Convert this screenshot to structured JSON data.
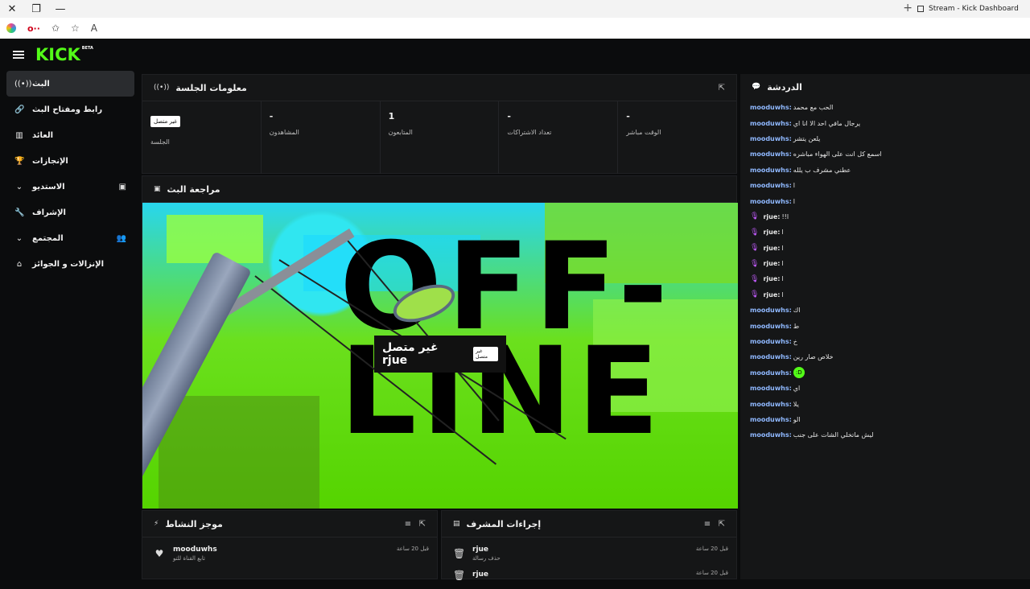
{
  "browser": {
    "tab_title": "Stream - Kick Dashboard",
    "close_glyph": "✕",
    "restore_glyph": "❐",
    "minimize_glyph": "—",
    "newtab_glyph": "+"
  },
  "app": {
    "logo": "KICK",
    "beta": "BETA"
  },
  "sidebar": {
    "items": [
      {
        "label": "البث",
        "icon": "((•))",
        "active": true
      },
      {
        "label": "رابط ومفتاح البث",
        "icon": "🔗"
      },
      {
        "label": "العائد",
        "icon": "▥"
      },
      {
        "label": "الإنجازات",
        "icon": "🏆"
      },
      {
        "label": "الاستديو",
        "icon": "⌄",
        "right_icon": "▣"
      },
      {
        "label": "الإشراف",
        "icon": "🔧"
      },
      {
        "label": "المجتمع",
        "icon": "⌄",
        "right_icon": "👥"
      },
      {
        "label": "الإنزالات و الجوائز",
        "icon": "⌂"
      }
    ]
  },
  "session_panel": {
    "title": "معلومات الجلسة",
    "stats": [
      {
        "value": "",
        "badge": "غير متصل",
        "label": "الجلسة"
      },
      {
        "value": "-",
        "label": "المشاهدون"
      },
      {
        "value": "1",
        "label": "المتابعون"
      },
      {
        "value": "-",
        "label": "تعداد الاشتراكات"
      },
      {
        "value": "-",
        "label": "الوقت مباشر"
      }
    ]
  },
  "preview_panel": {
    "title": "مراجعة البث",
    "offline_art": "OFF-\nLINE",
    "card_name": "غير متصل rjue",
    "card_badge": "غير متصل"
  },
  "chat": {
    "title": "الدردشة",
    "messages": [
      {
        "user": "mooduwhs:",
        "text": "الحب مع محمد"
      },
      {
        "user": "mooduwhs:",
        "text": "يرجال مافي احد الا انا اي"
      },
      {
        "user": "mooduwhs:",
        "text": "يلعن يتشر"
      },
      {
        "user": "mooduwhs:",
        "text": "اسمع كل انت على الهواء مباشره"
      },
      {
        "user": "mooduwhs:",
        "text": "عطني مشرف ب يلله"
      },
      {
        "user": "mooduwhs:",
        "text": "ا"
      },
      {
        "user": "mooduwhs:",
        "text": "ا"
      },
      {
        "user": "rjue:",
        "text": "!!ا",
        "mod": true
      },
      {
        "user": "rjue:",
        "text": "ا",
        "mod": true
      },
      {
        "user": "rjue:",
        "text": "ا",
        "mod": true
      },
      {
        "user": "rjue:",
        "text": "ا",
        "mod": true
      },
      {
        "user": "rjue:",
        "text": "ا",
        "mod": true
      },
      {
        "user": "rjue:",
        "text": "ا",
        "mod": true
      },
      {
        "user": "mooduwhs:",
        "text": "اك"
      },
      {
        "user": "mooduwhs:",
        "text": "ط"
      },
      {
        "user": "mooduwhs:",
        "text": "خ"
      },
      {
        "user": "mooduwhs:",
        "text": "خلاص صار رين"
      },
      {
        "user": "mooduwhs:",
        "text": "",
        "emote": ":D"
      },
      {
        "user": "mooduwhs:",
        "text": "اي"
      },
      {
        "user": "mooduwhs:",
        "text": "يلا"
      },
      {
        "user": "mooduwhs:",
        "text": "الو"
      },
      {
        "user": "mooduwhs:",
        "text": "ليش ماتخلي الشات على جنب"
      }
    ]
  },
  "activity_panel": {
    "title": "موجز النشاط",
    "rows": [
      {
        "name": "mooduwhs",
        "sub": "تابع القناة للتو",
        "time": "قبل 20 ساعة"
      }
    ]
  },
  "mod_panel": {
    "title": "إجراءات المشرف",
    "rows": [
      {
        "name": "rjue",
        "sub": "حذف رسالة",
        "time": "قبل 20 ساعة"
      },
      {
        "name": "rjue",
        "sub": "",
        "time": "قبل 20 ساعة"
      }
    ]
  },
  "colors": {
    "brand": "#53fc18",
    "username": "#8fb8ff",
    "panel": "#151617"
  }
}
